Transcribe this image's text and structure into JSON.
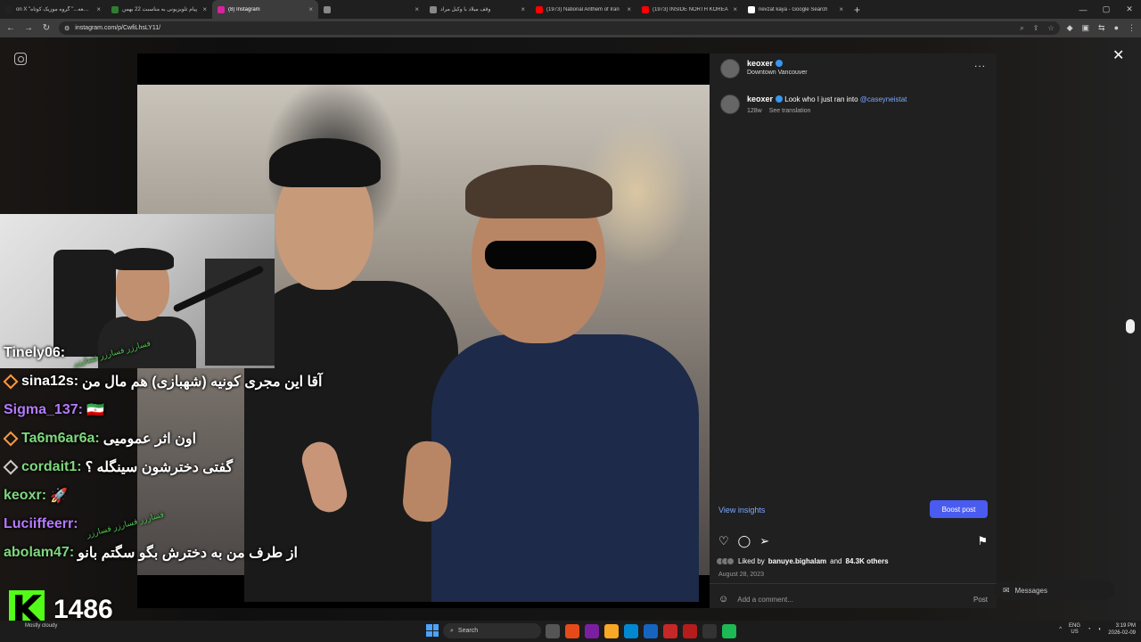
{
  "browser": {
    "tabs": [
      {
        "title": "on X \"دوران قطعه...\" گروه موزیک کوتاه",
        "favicon_color": "#222222",
        "active": false
      },
      {
        "title": "پیام تلویزیونی به مناسبت 22 بهمن",
        "favicon_color": "#2e7d32",
        "active": false
      },
      {
        "title": "(8) Instagram",
        "favicon_color": "#d6249f",
        "active": true
      },
      {
        "title": "",
        "favicon_color": "#888888",
        "active": false
      },
      {
        "title": "وقف میلاد با وکیل مراد",
        "favicon_color": "#888888",
        "active": false
      },
      {
        "title": "(1973) National Anthem of Iran",
        "favicon_color": "#ff0000",
        "active": false
      },
      {
        "title": "(1973) INSIDE NORTH KOREA",
        "favicon_color": "#ff0000",
        "active": false
      },
      {
        "title": "nevzat kaya - Google Search",
        "favicon_color": "#ffffff",
        "active": false
      }
    ],
    "new_tab_icon": "+",
    "url": "instagram.com/p/CwfiLhsLY11/"
  },
  "post": {
    "username": "keoxer",
    "location": "Downtown Vancouver",
    "caption_text": "Look who I just ran into",
    "caption_mention": "@caseyneistat",
    "age": "128w",
    "see_translation": "See translation",
    "view_insights": "View insights",
    "boost_post": "Boost post",
    "liked_by_prefix": "Liked by",
    "liked_by_user": "banuye.bighalam",
    "liked_by_and": "and",
    "liked_by_others": "84.3K others",
    "date": "August 28, 2023",
    "comment_placeholder": "Add a comment...",
    "post_label": "Post",
    "more_icon": "..."
  },
  "messages": {
    "label": "Messages"
  },
  "chat": [
    {
      "user": "Tinely06:",
      "color": "#ffffff",
      "badge_color": null,
      "message": "",
      "deco": "فسارزر فسارزر فسارزر"
    },
    {
      "user": "sina12s:",
      "color": "#ffffff",
      "badge_color": "#ff9a3c",
      "message": "آقا این مجری کونیه (شهبازی) هم مال من",
      "deco": ""
    },
    {
      "user": "Sigma_137:",
      "color": "#b57aff",
      "badge_color": null,
      "message": "🇮🇷",
      "deco": ""
    },
    {
      "user": "Ta6m6ar6a:",
      "color": "#7dd87d",
      "badge_color": "#ff9a3c",
      "message": "اون اثر عمومیی",
      "deco": ""
    },
    {
      "user": "cordait1:",
      "color": "#7dd87d",
      "badge_color": "#cccccc",
      "message": "گفتی دخترشون سینگله ؟",
      "deco": ""
    },
    {
      "user": "keoxr:",
      "color": "#7dd87d",
      "badge_color": null,
      "message": "🚀",
      "deco": ""
    },
    {
      "user": "Luciiffeerr:",
      "color": "#b57aff",
      "badge_color": null,
      "message": "",
      "deco": "فسارزر فسارزر فسارزر"
    },
    {
      "user": "abolam47:",
      "color": "#7dd87d",
      "badge_color": null,
      "message": "از طرف من به دخترش بگو سگتم بانو",
      "deco": ""
    }
  ],
  "counter": {
    "logo": "K",
    "value": "1486"
  },
  "taskbar": {
    "weather": "Mostly cloudy",
    "search": "Search",
    "lang_top": "ENG",
    "lang_bottom": "US",
    "time": "3:19 PM",
    "date": "2026-02-09"
  }
}
